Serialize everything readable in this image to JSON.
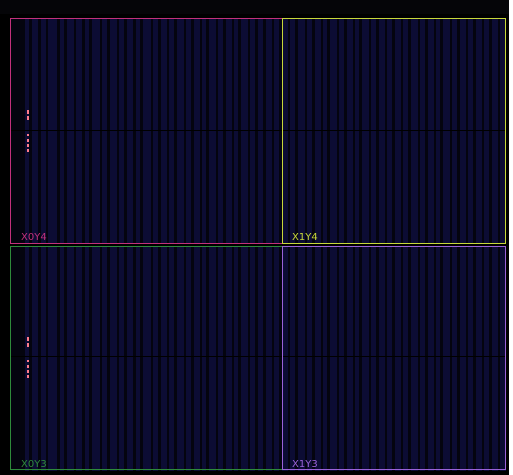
{
  "device_view": {
    "background_color": "#000000",
    "fabric_color": "#0c0c34",
    "regions": [
      {
        "label": "X0Y4",
        "border_color": "#c2307c",
        "label_color": "#c2307c"
      },
      {
        "label": "X1Y4",
        "border_color": "#c8d83a",
        "label_color": "#c8d83a"
      },
      {
        "label": "X0Y3",
        "border_color": "#2e8a3a",
        "label_color": "#2e8a3a"
      },
      {
        "label": "X1Y3",
        "border_color": "#9a62d8",
        "label_color": "#9a62d8"
      }
    ],
    "site_marker_color": "#ff7b8a"
  }
}
